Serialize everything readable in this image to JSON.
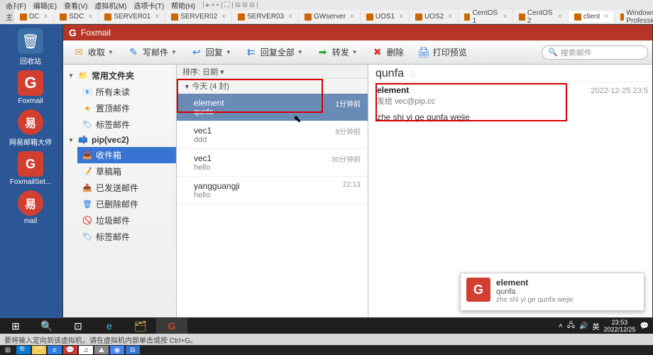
{
  "vmhost_menu": [
    "文件(F)",
    "编辑(E)",
    "查看(V)",
    "虚拟机(M)",
    "选项卡(T)",
    "帮助(H)"
  ],
  "vmtabs": {
    "home": "命 主页",
    "items": [
      "DC",
      "SDC",
      "SERVER01",
      "SERVER02",
      "SERVER03",
      "GWserver",
      "UOS1",
      "UOS2",
      "CentOS 1",
      "CentOS 2",
      "client",
      "Windows XP Professional"
    ],
    "active_index": 10
  },
  "desktop_icons": [
    "回收站",
    "Foxmail",
    "网易邮箱大师",
    "FoxmailSet...",
    "mail"
  ],
  "foxmail": {
    "title": "Foxmail",
    "toolbar": {
      "receive": "收取",
      "compose": "写邮件",
      "reply": "回复",
      "replyall": "回复全部",
      "forward": "转发",
      "delete": "删除",
      "print": "打印预览",
      "search_ph": "搜索邮件"
    },
    "tree": {
      "root": "常用文件夹",
      "root_children": [
        "所有未读",
        "置顶邮件",
        "标签邮件"
      ],
      "account": "pip(vec2)",
      "account_children": [
        "收件箱",
        "草稿箱",
        "已发送邮件",
        "已删除邮件",
        "垃圾邮件",
        "标签邮件"
      ],
      "selected": "收件箱"
    },
    "list": {
      "sorter": "排序: 日期 ▾",
      "group": "今天 (4 封)",
      "messages": [
        {
          "from": "element",
          "subj": "qunfa",
          "time": "1分钟前",
          "sel": true
        },
        {
          "from": "vec1",
          "subj": "ddd",
          "time": "8分钟前"
        },
        {
          "from": "vec1",
          "subj": "hello",
          "time": "30分钟前"
        },
        {
          "from": "yangguangji",
          "subj": "hello",
          "time": "22:13"
        }
      ]
    },
    "preview": {
      "subject": "qunfa",
      "sender": "element",
      "rcpt_label": "发给 vec@pip.cc",
      "date": "2022-12-25 23:5",
      "body": "zhe shi yi ge qunfa wejie"
    }
  },
  "notification": {
    "l1": "element",
    "l2": "qunfa",
    "l3": "zhe shi yi ge qunfa wejie"
  },
  "taskbar": {
    "ime": "英",
    "time": "23:53",
    "date": "2022/12/25"
  },
  "hostinfo": "要将输入定向到该虚拟机，请在虚拟机内部单击或按 Ctrl+G。"
}
